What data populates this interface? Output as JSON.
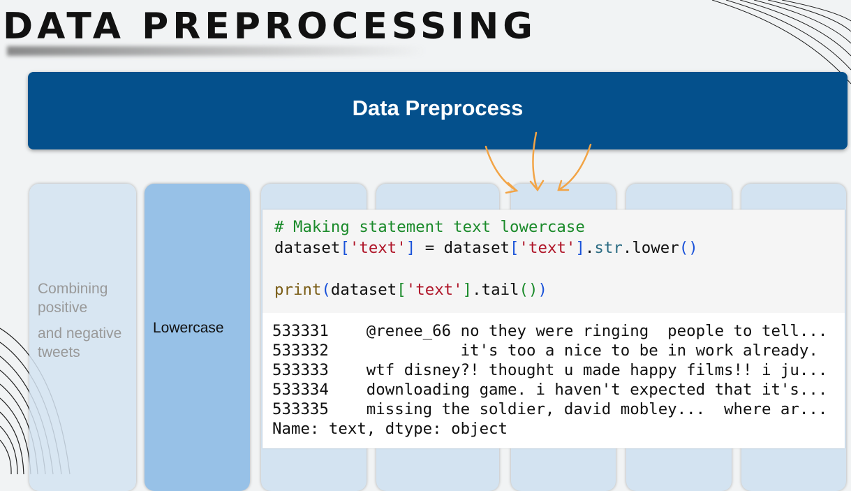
{
  "slide_title": "DATA PREPROCESSING",
  "header": "Data Preprocess",
  "steps": [
    {
      "label": "Combining positive",
      "label2": "and negative tweets"
    },
    {
      "label": "Lowercase"
    }
  ],
  "code": {
    "comment": "# Making statement text lowercase",
    "line1": {
      "a": "dataset",
      "b": "[",
      "s": "'text'",
      "c": "]",
      "d": " = dataset",
      "e": "[",
      "s2": "'text'",
      "f": "]",
      ".g": ".",
      "m": "str",
      ".h": ".lower",
      "p": "()"
    },
    "line3": {
      "print": "print",
      "p1": "(",
      "a": "dataset",
      "b": "[",
      "s": "'text'",
      "c": "]",
      ".d": ".tail",
      "p2": "()",
      "p3": ")"
    }
  },
  "output": [
    "533331    @renee_66 no they were ringing  people to tell...",
    "533332              it's too a nice to be in work already.",
    "533333    wtf disney?! thought u made happy films!! i ju...",
    "533334    downloading game. i haven't expected that it's...",
    "533335    missing the soldier, david mobley...  where ar...",
    "Name: text, dtype: object"
  ],
  "colors": {
    "header": "#04508c",
    "card": "#d3e3f1",
    "active_card": "#97c1e7",
    "arrow": "#f2a446"
  }
}
